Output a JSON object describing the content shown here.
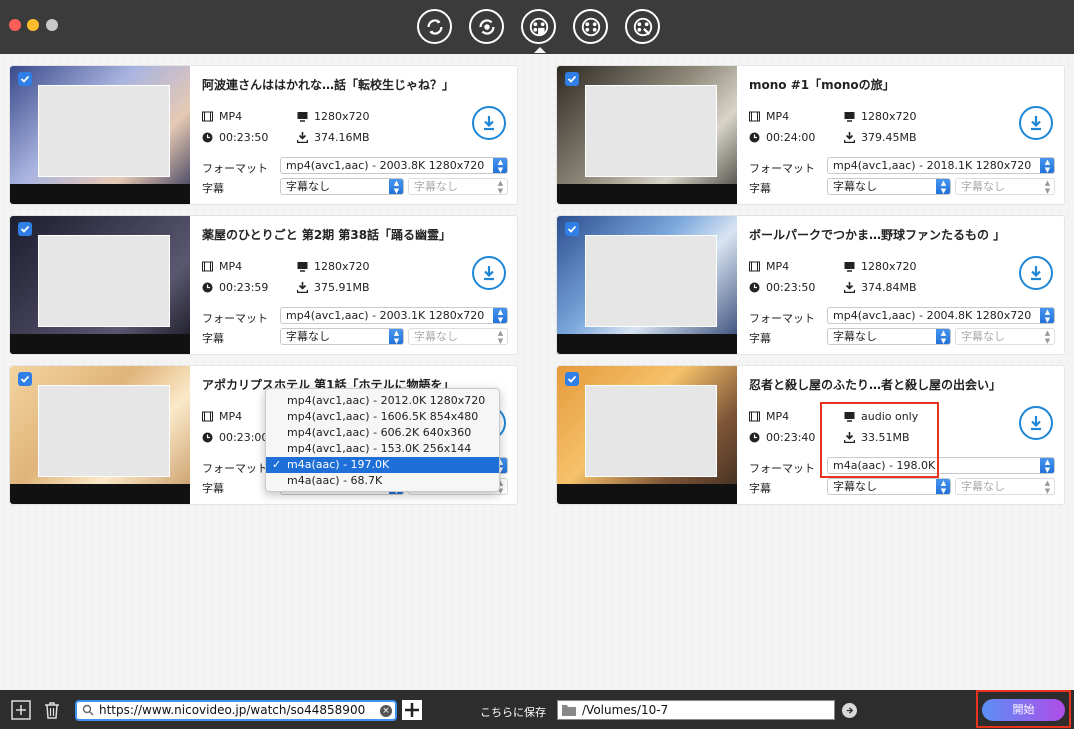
{
  "toolbar": {
    "buttons": [
      "convert-icon",
      "record-icon",
      "video-download-icon",
      "video-edit-icon",
      "video-tools-icon"
    ],
    "active_index": 2
  },
  "labels": {
    "format": "フォーマット",
    "subtitle": "字幕"
  },
  "cards": [
    {
      "title": "阿波連さんははかれな…話「転校生じゃね？」",
      "format": "MP4",
      "resolution": "1280x720",
      "duration": "00:23:50",
      "size": "374.16MB",
      "format_select": "mp4(avc1,aac) - 2003.8K 1280x720",
      "subtitle_select": "字幕なし",
      "subtitle_select2": "字幕なし",
      "checked": true
    },
    {
      "title": "mono #1「monoの旅」",
      "format": "MP4",
      "resolution": "1280x720",
      "duration": "00:24:00",
      "size": "379.45MB",
      "format_select": "mp4(avc1,aac) - 2018.1K 1280x720",
      "subtitle_select": "字幕なし",
      "subtitle_select2": "字幕なし",
      "checked": true
    },
    {
      "title": "薬屋のひとりごと 第2期 第38話「踊る幽霊」",
      "format": "MP4",
      "resolution": "1280x720",
      "duration": "00:23:59",
      "size": "375.91MB",
      "format_select": "mp4(avc1,aac) - 2003.1K 1280x720",
      "subtitle_select": "字幕なし",
      "subtitle_select2": "字幕なし",
      "checked": true
    },
    {
      "title": "ボールパークでつかま…野球ファンたるもの 」",
      "format": "MP4",
      "resolution": "1280x720",
      "duration": "00:23:50",
      "size": "374.84MB",
      "format_select": "mp4(avc1,aac) - 2004.8K 1280x720",
      "subtitle_select": "字幕なし",
      "subtitle_select2": "字幕なし",
      "checked": true
    },
    {
      "title": "アポカリプスホテル 第1話「ホテルに物語を」",
      "format": "MP4",
      "resolution": "",
      "duration": "00:23:00",
      "size": "",
      "format_select": "m4a(aac) - 197.0K",
      "subtitle_select": "字幕なし",
      "subtitle_select2": "字幕なし",
      "checked": true
    },
    {
      "title": "忍者と殺し屋のふたり…者と殺し屋の出会い」",
      "format": "MP4",
      "resolution": "audio only",
      "duration": "00:23:40",
      "size": "33.51MB",
      "format_select": "m4a(aac) - 198.0K",
      "subtitle_select": "字幕なし",
      "subtitle_select2": "字幕なし",
      "checked": true
    }
  ],
  "dropdown": {
    "options": [
      "mp4(avc1,aac) - 2012.0K 1280x720",
      "mp4(avc1,aac) - 1606.5K 854x480",
      "mp4(avc1,aac) - 606.2K 640x360",
      "mp4(avc1,aac) - 153.0K 256x144",
      "m4a(aac) - 197.0K",
      "m4a(aac) - 68.7K"
    ],
    "selected_index": 4,
    "check_mark": "✓"
  },
  "bottom": {
    "url": "https://www.nicovideo.jp/watch/so44858900",
    "save_label": "こちらに保存",
    "save_path": "/Volumes/10-7",
    "start_label": "開始"
  },
  "colors": {
    "accent": "#1f6fd8",
    "highlight": "#e8331f",
    "download_ring": "#1e86d6"
  }
}
